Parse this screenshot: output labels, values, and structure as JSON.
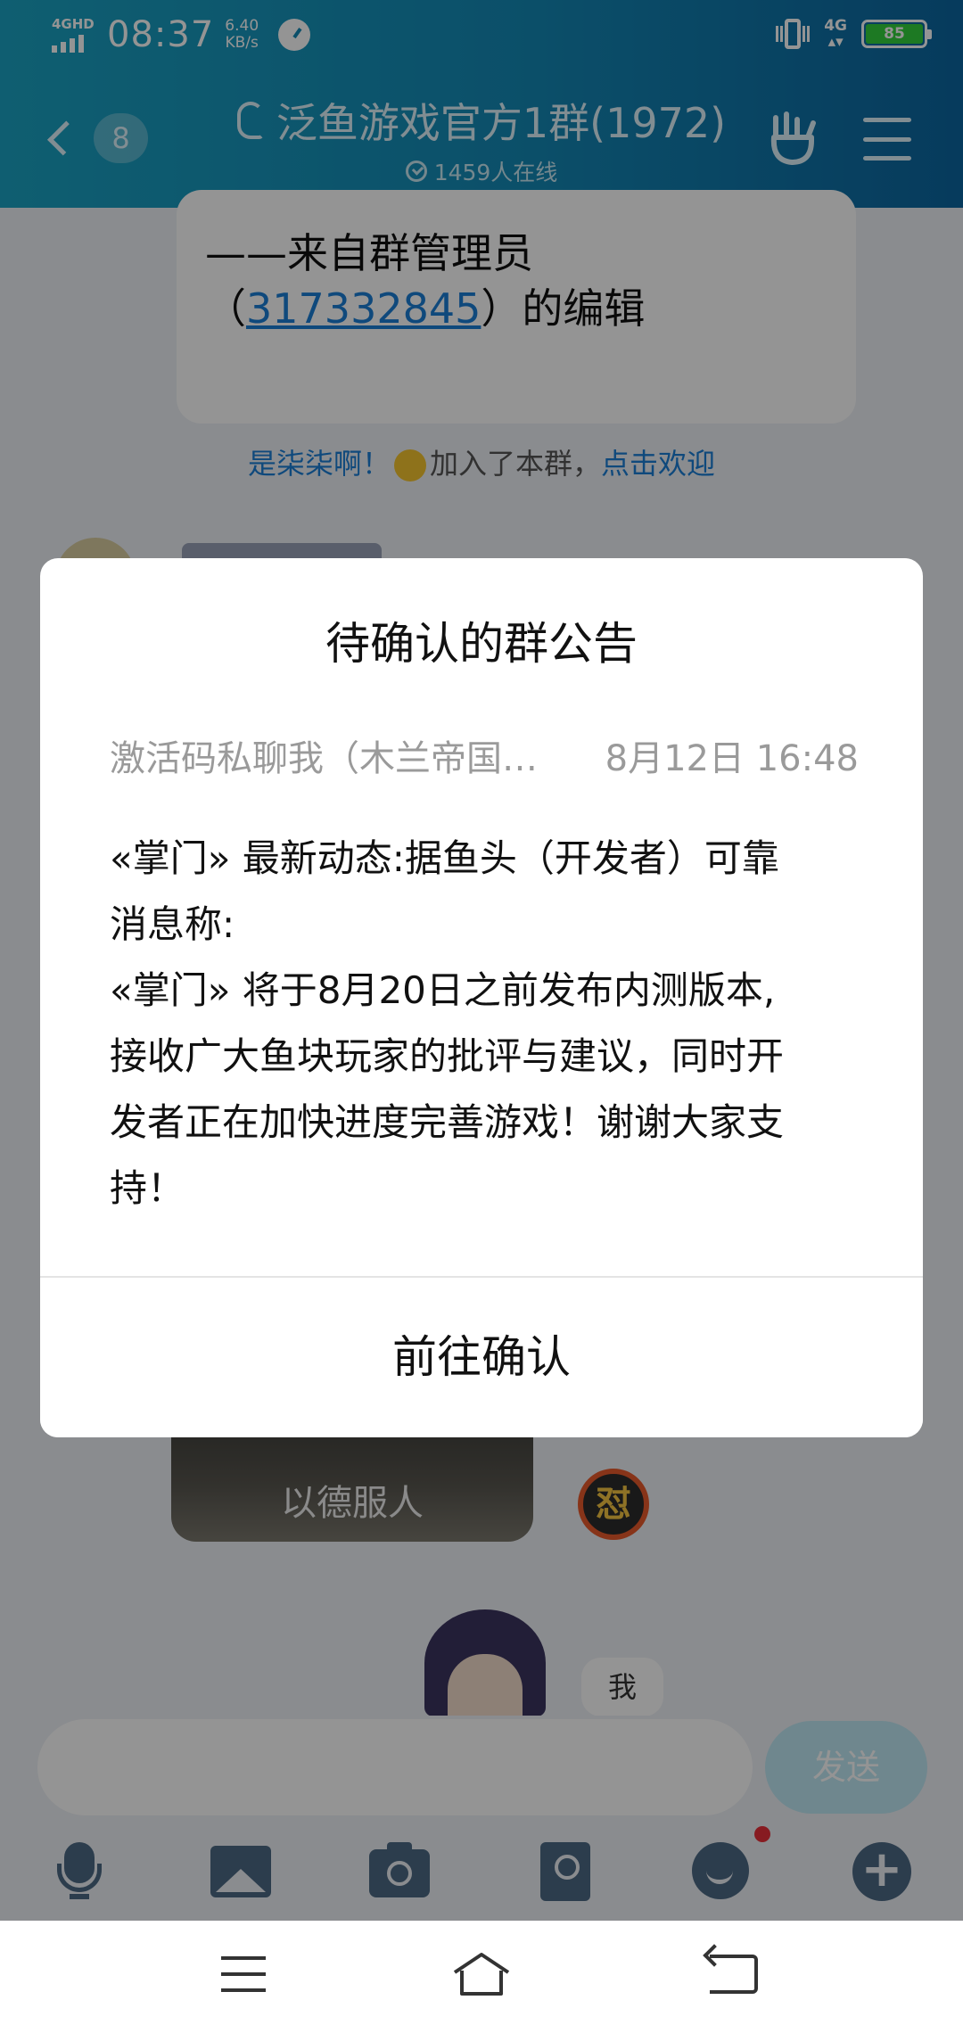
{
  "status_bar": {
    "network": "4GHD",
    "time": "08:37",
    "speed_value": "6.40",
    "speed_unit": "KB/s",
    "right_network": "4G",
    "battery": "85"
  },
  "header": {
    "back_count": "8",
    "title": "泛鱼游戏官方1群(1972)",
    "online": "1459人在线"
  },
  "chat": {
    "notice_card": {
      "line1": "——来自群管理员",
      "paren_open": "（",
      "admin_id": "317332845",
      "paren_close": "）的编辑"
    },
    "join_message": {
      "name": "是柒柒啊！",
      "middle": "加入了本群，",
      "welcome": "点击欢迎"
    },
    "video_caption": "以德服人",
    "sticker_text": "怼",
    "my_message": "我"
  },
  "input": {
    "placeholder": "",
    "send_label": "发送"
  },
  "toolbar": {
    "items": [
      "microphone-icon",
      "image-icon",
      "camera-icon",
      "red-packet-icon",
      "emoji-icon",
      "plus-icon"
    ]
  },
  "dialog": {
    "title": "待确认的群公告",
    "author": "激活码私聊我（木兰帝国…",
    "date": "8月12日  16:48",
    "body_lines": [
      "«掌门» 最新动态:据鱼头（开发者）可靠",
      "消息称:",
      "«掌门» 将于8月20日之前发布内测版本,",
      "接收广大鱼块玩家的批评与建议，同时开",
      "发者正在加快进度完善游戏！谢谢大家支",
      "持！"
    ],
    "confirm_label": "前往确认"
  },
  "colors": {
    "header_start": "#1aa3c3",
    "header_end": "#0c66a0",
    "link": "#1b7ed6",
    "send_button": "#bfe8f5",
    "battery": "#33d13d"
  }
}
